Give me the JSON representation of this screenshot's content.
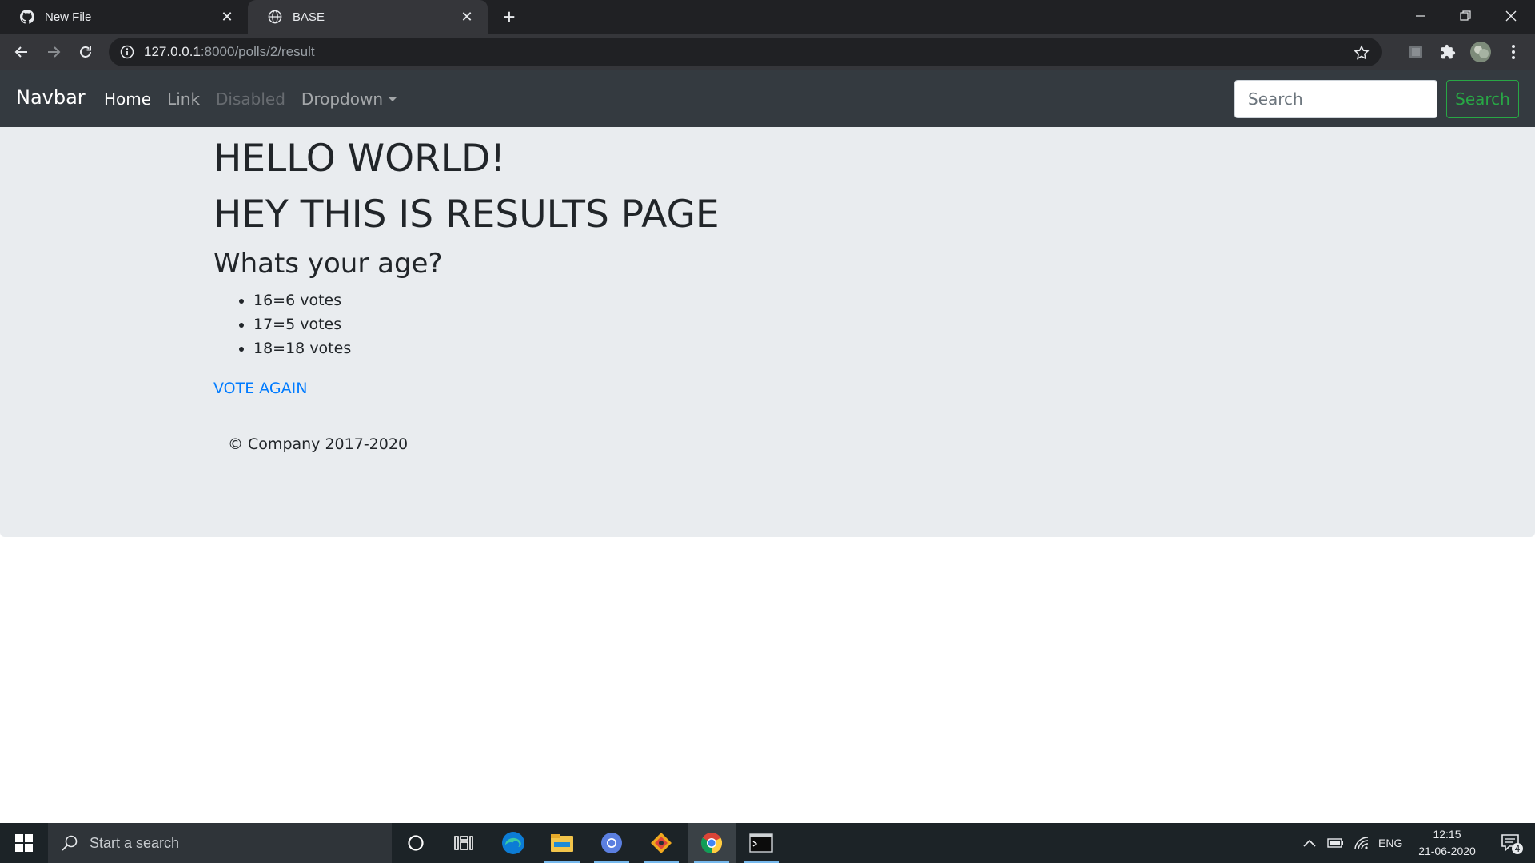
{
  "browser": {
    "tabs": [
      {
        "title": "New File",
        "favicon": "github-icon",
        "active": false
      },
      {
        "title": "BASE",
        "favicon": "globe-icon",
        "active": true
      }
    ],
    "url_host": "127.0.0.1",
    "url_path": ":8000/polls/2/result"
  },
  "navbar": {
    "brand": "Navbar",
    "items": {
      "home": "Home",
      "link": "Link",
      "disabled": "Disabled",
      "dropdown": "Dropdown"
    },
    "search_placeholder": "Search",
    "search_button": "Search"
  },
  "page": {
    "heading1": "HELLO WORLD!",
    "heading2": "HEY THIS IS RESULTS PAGE",
    "question": "Whats your age?",
    "choices": [
      {
        "text": "16=6 votes"
      },
      {
        "text": "17=5 votes"
      },
      {
        "text": "18=18 votes"
      }
    ],
    "vote_again": "VOTE AGAIN",
    "footer": "© Company 2017-2020"
  },
  "taskbar": {
    "search_placeholder": "Start a search",
    "language": "ENG",
    "time": "12:15",
    "date": "21-06-2020",
    "notification_count": "4"
  },
  "colors": {
    "navbar_bg": "#343a40",
    "jumbotron_bg": "#e9ecef",
    "link_blue": "#007bff",
    "success_green": "#28a745"
  }
}
